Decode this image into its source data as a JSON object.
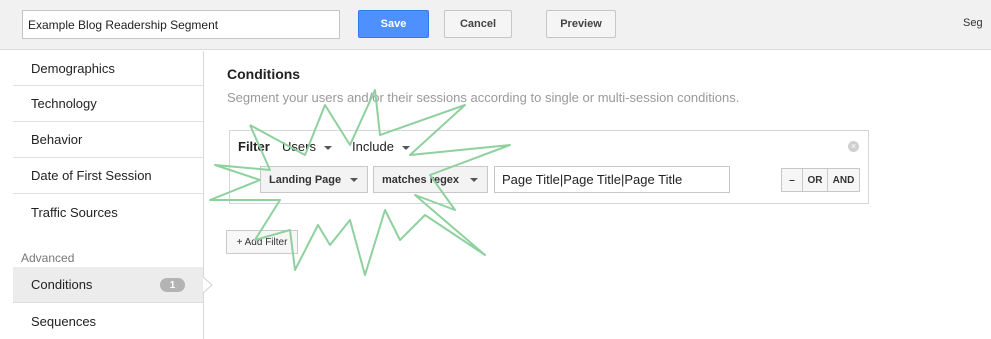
{
  "header": {
    "segment_name": "Example Blog Readership Segment",
    "save_label": "Save",
    "cancel_label": "Cancel",
    "preview_label": "Preview",
    "right_cut_text": "Seg"
  },
  "sidebar": {
    "items": [
      "Demographics",
      "Technology",
      "Behavior",
      "Date of First Session",
      "Traffic Sources"
    ],
    "advanced_label": "Advanced",
    "conditions_label": "Conditions",
    "conditions_count": "1",
    "sequences_label": "Sequences"
  },
  "main": {
    "title": "Conditions",
    "subtitle": "Segment your users and/or their sessions according to single or multi-session conditions."
  },
  "filter": {
    "label": "Filter",
    "scope": "Users",
    "mode": "Include",
    "dimension": "Landing Page",
    "operator": "matches regex",
    "value": "Page Title|Page Title|Page Title",
    "minus_label": "–",
    "or_label": "OR",
    "and_label": "AND",
    "add_filter_label": "+ Add Filter"
  },
  "colors": {
    "primary_button": "#4d90fe",
    "annotation_stroke": "#8fd19e"
  }
}
